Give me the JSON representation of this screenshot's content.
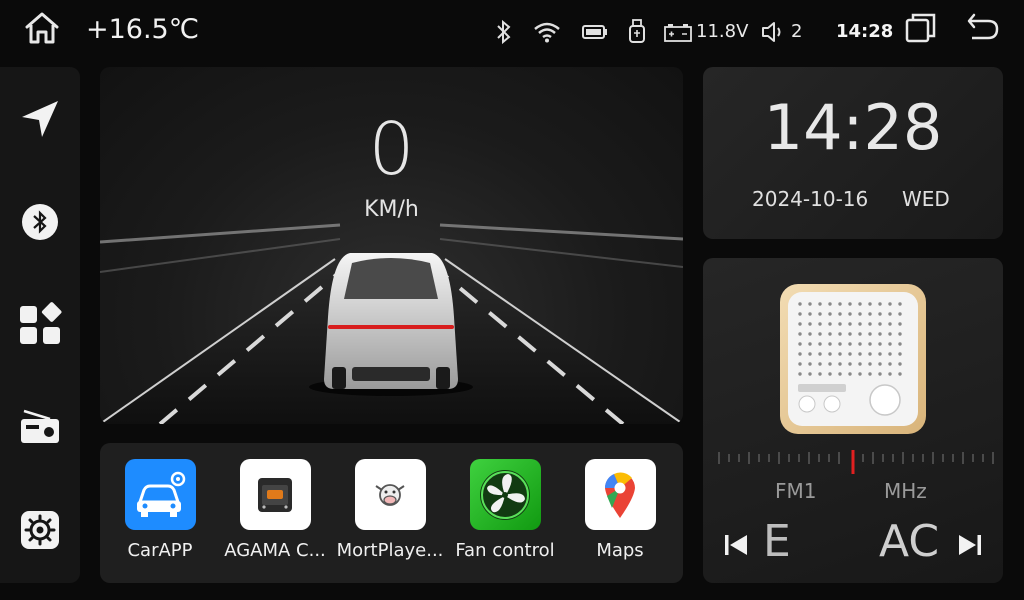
{
  "status_bar": {
    "temperature": "+16.5℃",
    "voltage": "11.8V",
    "volume": "2",
    "time": "14:28"
  },
  "dashboard": {
    "speed": "0",
    "speed_unit": "KM/h"
  },
  "clock": {
    "time": "14:28",
    "date": "2024-10-16",
    "weekday": "WED"
  },
  "radio": {
    "band": "FM1",
    "unit": "MHz",
    "station_left": "E",
    "station_right": "AC"
  },
  "apps": [
    {
      "label": "CarAPP",
      "icon": "car-settings-icon",
      "color": "#1e8cff"
    },
    {
      "label": "AGAMA C...",
      "icon": "agama-icon",
      "color": "#ffffff"
    },
    {
      "label": "MortPlaye...",
      "icon": "cow-icon",
      "color": "#ffffff"
    },
    {
      "label": "Fan control",
      "icon": "fan-icon",
      "color": "#2ecc2e"
    },
    {
      "label": "Maps",
      "icon": "maps-icon",
      "color": "#ffffff"
    }
  ],
  "colors": {
    "accent_red": "#d81e1e",
    "tuner_needle": "#e02020"
  }
}
